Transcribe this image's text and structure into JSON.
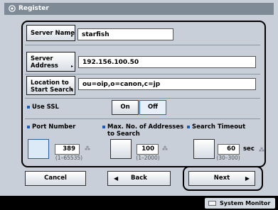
{
  "window": {
    "title": "Register"
  },
  "server_name": {
    "button_label": "Server Name",
    "value": "starfish"
  },
  "server_address": {
    "button_label_1": "Server",
    "button_label_2": "Address",
    "value": "192.156.100.50"
  },
  "location": {
    "button_label_1": "Location to",
    "button_label_2": "Start Search",
    "value": "ou=oip,o=canon,c=jp"
  },
  "ssl": {
    "label": "Use SSL",
    "on_label": "On",
    "off_label": "Off",
    "selected": "Off"
  },
  "port": {
    "label": "Port Number",
    "value": "389",
    "range": "(1–65535)"
  },
  "max_addresses": {
    "label_1": "Max. No. of Addresses",
    "label_2": "to Search",
    "value": "100",
    "range": "(1–2000)"
  },
  "timeout": {
    "label": "Search Timeout",
    "value": "60",
    "unit": "sec",
    "range": "(30–300)"
  },
  "footer": {
    "cancel": "Cancel",
    "back": "Back",
    "next": "Next"
  },
  "status_bar": {
    "system_monitor": "System Monitor"
  },
  "colors": {
    "screen_bg": "#c8cfd9",
    "title_bg": "#7e8b97",
    "selected_toggle": "#e7f0f8",
    "bullet": "#1a5bbd"
  }
}
